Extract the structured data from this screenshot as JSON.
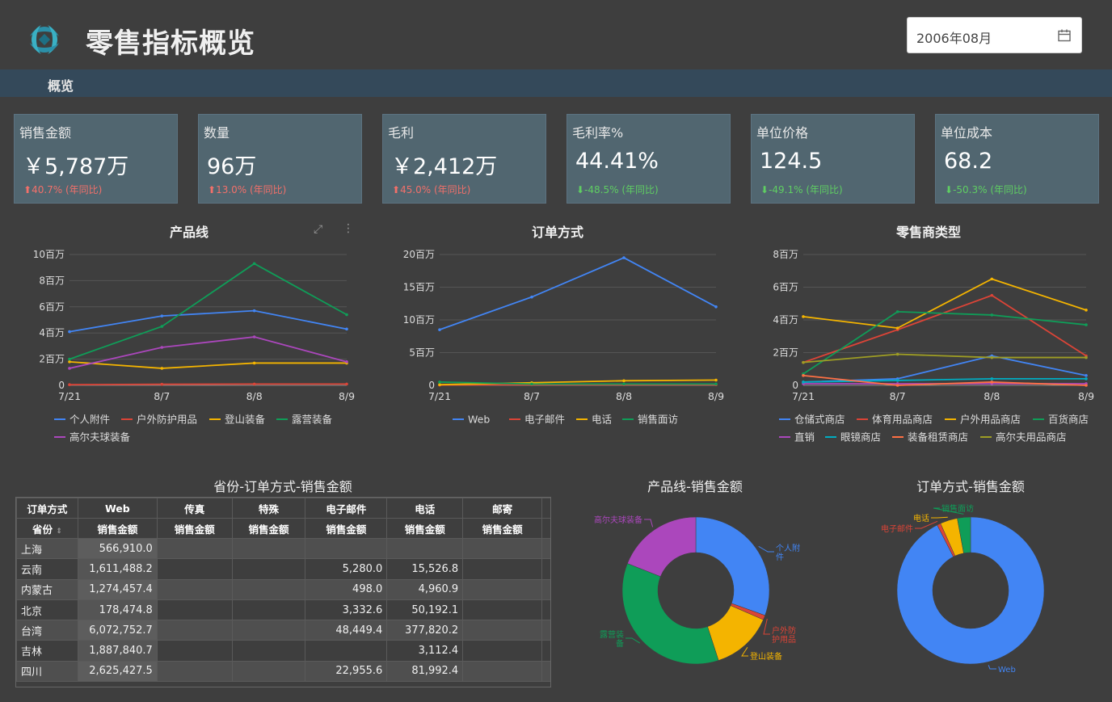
{
  "header": {
    "title": "零售指标概览",
    "date_value": "2006年08月"
  },
  "nav": {
    "overview": "概览"
  },
  "kpis": [
    {
      "label": "销售金额",
      "value": "￥5,787万",
      "change": "40.7% (年同比)",
      "dir": "up"
    },
    {
      "label": "数量",
      "value": "96万",
      "change": "13.0% (年同比)",
      "dir": "up"
    },
    {
      "label": "毛利",
      "value": "￥2,412万",
      "change": "45.0% (年同比)",
      "dir": "up"
    },
    {
      "label": "毛利率%",
      "value": "44.41%",
      "change": "-48.5% (年同比)",
      "dir": "down"
    },
    {
      "label": "单位价格",
      "value": "124.5",
      "change": "-49.1% (年同比)",
      "dir": "down"
    },
    {
      "label": "单位成本",
      "value": "68.2",
      "change": "-50.3% (年同比)",
      "dir": "down"
    }
  ],
  "chart_data": [
    {
      "type": "line",
      "title": "产品线",
      "categories": [
        "7/21",
        "8/7",
        "8/8",
        "8/9"
      ],
      "yticks": [
        "0",
        "2百万",
        "4百万",
        "6百万",
        "8百万",
        "10百万"
      ],
      "ylim": [
        0,
        10
      ],
      "series": [
        {
          "name": "个人附件",
          "color": "#4285f4",
          "values": [
            4.1,
            5.3,
            5.7,
            4.3
          ]
        },
        {
          "name": "户外防护用品",
          "color": "#db4437",
          "values": [
            0.05,
            0.08,
            0.1,
            0.1
          ]
        },
        {
          "name": "登山装备",
          "color": "#f4b400",
          "values": [
            1.8,
            1.3,
            1.7,
            1.7
          ]
        },
        {
          "name": "露营装备",
          "color": "#0f9d58",
          "values": [
            2.0,
            4.5,
            9.3,
            5.4
          ]
        },
        {
          "name": "高尔夫球装备",
          "color": "#ab47bc",
          "values": [
            1.3,
            2.9,
            3.7,
            1.8
          ]
        }
      ]
    },
    {
      "type": "line",
      "title": "订单方式",
      "categories": [
        "7/21",
        "8/7",
        "8/8",
        "8/9"
      ],
      "yticks": [
        "0",
        "5百万",
        "10百万",
        "15百万",
        "20百万"
      ],
      "ylim": [
        0,
        20
      ],
      "series": [
        {
          "name": "Web",
          "color": "#4285f4",
          "values": [
            8.5,
            13.5,
            19.5,
            12.0
          ]
        },
        {
          "name": "电子邮件",
          "color": "#db4437",
          "values": [
            0.05,
            0.1,
            0.1,
            0.1
          ]
        },
        {
          "name": "电话",
          "color": "#f4b400",
          "values": [
            0.1,
            0.4,
            0.7,
            0.8
          ]
        },
        {
          "name": "销售面访",
          "color": "#0f9d58",
          "values": [
            0.5,
            0.2,
            0.2,
            0.2
          ]
        }
      ]
    },
    {
      "type": "line",
      "title": "零售商类型",
      "categories": [
        "7/21",
        "8/7",
        "8/8",
        "8/9"
      ],
      "yticks": [
        "0",
        "2百万",
        "4百万",
        "6百万",
        "8百万"
      ],
      "ylim": [
        0,
        8
      ],
      "series": [
        {
          "name": "仓储式商店",
          "color": "#4285f4",
          "values": [
            0.2,
            0.4,
            1.8,
            0.6
          ]
        },
        {
          "name": "体育用品商店",
          "color": "#db4437",
          "values": [
            1.4,
            3.4,
            5.5,
            1.8
          ]
        },
        {
          "name": "户外用品商店",
          "color": "#f4b400",
          "values": [
            4.2,
            3.5,
            6.5,
            4.6
          ]
        },
        {
          "name": "百货商店",
          "color": "#0f9d58",
          "values": [
            0.7,
            4.5,
            4.3,
            3.7
          ]
        },
        {
          "name": "直销",
          "color": "#ab47bc",
          "values": [
            0.1,
            0.1,
            0.1,
            0.1
          ]
        },
        {
          "name": "眼镜商店",
          "color": "#00acc1",
          "values": [
            0.2,
            0.3,
            0.4,
            0.4
          ]
        },
        {
          "name": "装备租赁商店",
          "color": "#ff7043",
          "values": [
            0.6,
            0.0,
            0.2,
            0.0
          ]
        },
        {
          "name": "高尔夫用品商店",
          "color": "#9e9d24",
          "values": [
            1.4,
            1.9,
            1.7,
            1.7
          ]
        }
      ]
    },
    {
      "type": "table",
      "title": "省份-订单方式-销售金额",
      "header_row1_label": "订单方式",
      "header_row2_label": "省份",
      "columns": [
        "Web",
        "传真",
        "特殊",
        "电子邮件",
        "电话",
        "邮寄"
      ],
      "measure": "销售金额",
      "rows": [
        [
          "上海",
          "566,910.0",
          "",
          "",
          "",
          "",
          ""
        ],
        [
          "云南",
          "1,611,488.2",
          "",
          "",
          "5,280.0",
          "15,526.8",
          ""
        ],
        [
          "内蒙古",
          "1,274,457.4",
          "",
          "",
          "498.0",
          "4,960.9",
          ""
        ],
        [
          "北京",
          "178,474.8",
          "",
          "",
          "3,332.6",
          "50,192.1",
          ""
        ],
        [
          "台湾",
          "6,072,752.7",
          "",
          "",
          "48,449.4",
          "377,820.2",
          ""
        ],
        [
          "吉林",
          "1,887,840.7",
          "",
          "",
          "",
          "3,112.4",
          ""
        ],
        [
          "四川",
          "2,625,427.5",
          "",
          "",
          "22,955.6",
          "81,992.4",
          ""
        ]
      ]
    },
    {
      "type": "pie",
      "title": "产品线-销售金额",
      "slices": [
        {
          "name": "个人附件",
          "value": 30.5,
          "color": "#4285f4"
        },
        {
          "name": "户外防护用品",
          "value": 1.0,
          "color": "#db4437"
        },
        {
          "name": "登山装备",
          "value": 13.5,
          "color": "#f4b400"
        },
        {
          "name": "露营装备",
          "value": 36.0,
          "color": "#0f9d58"
        },
        {
          "name": "高尔夫球装备",
          "value": 19.0,
          "color": "#ab47bc"
        }
      ]
    },
    {
      "type": "pie",
      "title": "订单方式-销售金额",
      "slices": [
        {
          "name": "Web",
          "value": 92.5,
          "color": "#4285f4"
        },
        {
          "name": "电子邮件",
          "value": 0.8,
          "color": "#db4437"
        },
        {
          "name": "电话",
          "value": 3.8,
          "color": "#f4b400"
        },
        {
          "name": "销售面访",
          "value": 2.9,
          "color": "#0f9d58"
        }
      ]
    }
  ]
}
